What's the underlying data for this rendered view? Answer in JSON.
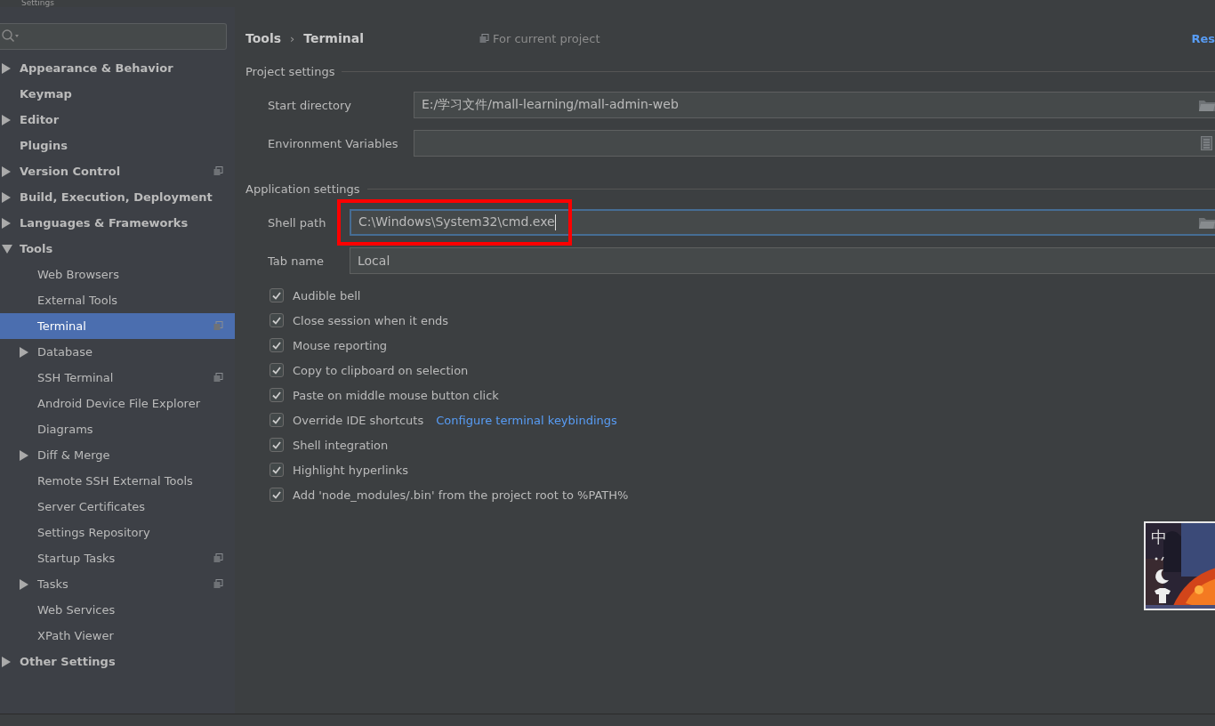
{
  "window": {
    "title": "Settings"
  },
  "sidebar": {
    "items": [
      {
        "label": "Appearance & Behavior",
        "expanded": false,
        "selected": false,
        "project_icon": false
      },
      {
        "label": "Keymap",
        "selected": false,
        "project_icon": false
      },
      {
        "label": "Editor",
        "expanded": false,
        "selected": false,
        "project_icon": false
      },
      {
        "label": "Plugins",
        "selected": false,
        "project_icon": false
      },
      {
        "label": "Version Control",
        "expanded": false,
        "selected": false,
        "project_icon": true
      },
      {
        "label": "Build, Execution, Deployment",
        "expanded": false,
        "selected": false,
        "project_icon": false
      },
      {
        "label": "Languages & Frameworks",
        "expanded": false,
        "selected": false,
        "project_icon": false
      },
      {
        "label": "Tools",
        "expanded": true,
        "selected": false,
        "project_icon": false,
        "children": [
          {
            "label": "Web Browsers",
            "selected": false,
            "project_icon": false
          },
          {
            "label": "External Tools",
            "selected": false,
            "project_icon": false
          },
          {
            "label": "Terminal",
            "selected": true,
            "project_icon": true
          },
          {
            "label": "Database",
            "expanded": false,
            "selected": false,
            "project_icon": false
          },
          {
            "label": "SSH Terminal",
            "selected": false,
            "project_icon": true
          },
          {
            "label": "Android Device File Explorer",
            "selected": false,
            "project_icon": false
          },
          {
            "label": "Diagrams",
            "selected": false,
            "project_icon": false
          },
          {
            "label": "Diff & Merge",
            "expanded": false,
            "selected": false,
            "project_icon": false
          },
          {
            "label": "Remote SSH External Tools",
            "selected": false,
            "project_icon": false
          },
          {
            "label": "Server Certificates",
            "selected": false,
            "project_icon": false
          },
          {
            "label": "Settings Repository",
            "selected": false,
            "project_icon": false
          },
          {
            "label": "Startup Tasks",
            "selected": false,
            "project_icon": true
          },
          {
            "label": "Tasks",
            "expanded": false,
            "selected": false,
            "project_icon": true
          },
          {
            "label": "Web Services",
            "selected": false,
            "project_icon": false
          },
          {
            "label": "XPath Viewer",
            "selected": false,
            "project_icon": false
          }
        ]
      },
      {
        "label": "Other Settings",
        "expanded": false,
        "selected": false,
        "project_icon": false
      }
    ]
  },
  "header": {
    "breadcrumb": [
      "Tools",
      "Terminal"
    ],
    "separator": "›",
    "scope": "For current project",
    "reset": "Res"
  },
  "project_settings": {
    "title": "Project settings",
    "fields": [
      {
        "label": "Start directory",
        "value": "E:/学习文件/mall-learning/mall-admin-web",
        "kind": "directory",
        "highlighted": false,
        "focused": false
      },
      {
        "label": "Environment Variables",
        "kind": "variables",
        "highlighted": false,
        "focused": false
      }
    ]
  },
  "application_settings": {
    "title": "Application settings",
    "fields": [
      {
        "label": "Shell path",
        "value": "C:\\Windows\\System32\\cmd.exe",
        "kind": "directory",
        "highlighted": true,
        "focused": true
      },
      {
        "label": "Tab name",
        "value": "Local",
        "kind": "text",
        "highlighted": false,
        "focused": false
      }
    ],
    "options": [
      {
        "label": "Audible bell",
        "checked": true
      },
      {
        "label": "Close session when it ends",
        "checked": true
      },
      {
        "label": "Mouse reporting",
        "checked": true
      },
      {
        "label": "Copy to clipboard on selection",
        "checked": true
      },
      {
        "label": "Paste on middle mouse button click",
        "checked": true
      },
      {
        "label": "Override IDE shortcuts",
        "checked": true,
        "link": "Configure terminal keybindings"
      },
      {
        "label": "Shell integration",
        "checked": true
      },
      {
        "label": "Highlight hyperlinks",
        "checked": true
      },
      {
        "label": "Add 'node_modules/.bin' from the project root to %PATH%",
        "checked": true
      }
    ]
  },
  "ime_widget": {
    "mode": "中",
    "kind": "picture"
  }
}
